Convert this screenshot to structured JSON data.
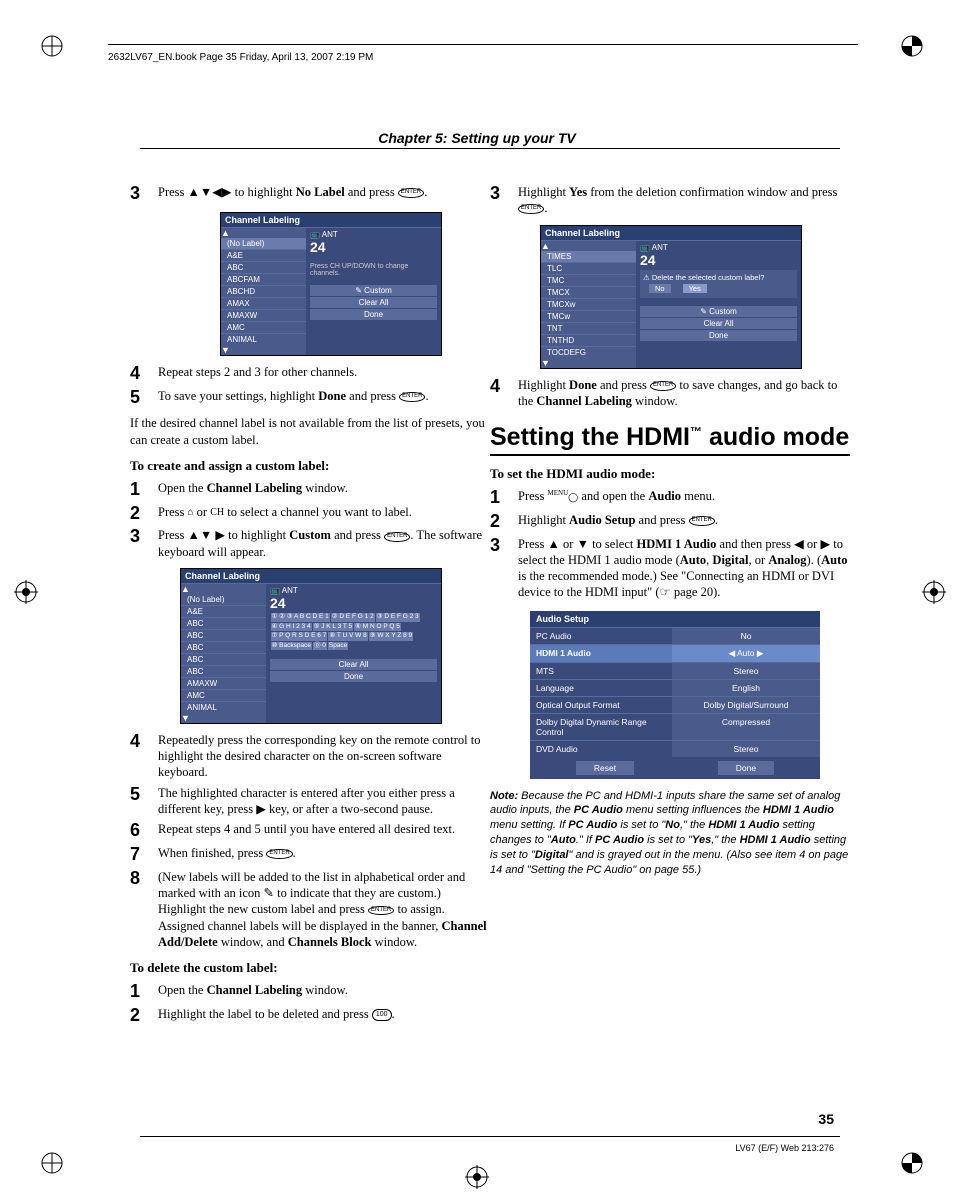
{
  "header": "2632LV67_EN.book  Page 35  Friday, April 13, 2007  2:19 PM",
  "chapter": "Chapter 5: Setting up your TV",
  "left": {
    "s3": {
      "pre": "Press ",
      "arrows": "▲▼◀▶",
      "mid": " to highlight ",
      "bold": "No Label",
      "post": " and press ",
      "enter": "ENTER",
      "end": "."
    },
    "menu1": {
      "title": "Channel Labeling",
      "items": [
        "(No Label)",
        "A&E",
        "ABC",
        "ABCFAM",
        "ABCHD",
        "AMAX",
        "AMAXW",
        "AMC",
        "ANIMAL"
      ],
      "ant": "ANT",
      "ch": "24",
      "hint": "Press CH UP/DOWN to change channels.",
      "btns": [
        "Custom",
        "Clear All",
        "Done"
      ]
    },
    "s4": "Repeat steps 2 and 3 for other channels.",
    "s5": {
      "pre": "To save your settings, highlight ",
      "bold": "Done",
      "post": " and press ",
      "enter": "ENTER",
      "end": "."
    },
    "para1": "If the desired channel label is not available from the list of presets, you can create a custom label.",
    "sub1": "To create and assign a custom label:",
    "c1": {
      "pre": "Open the ",
      "bold": "Channel Labeling",
      "post": " window."
    },
    "c2": {
      "pre": "Press ",
      "i1": "⌂",
      "mid": " or ",
      "i2": "CH",
      "post": " to select a channel you want to label."
    },
    "c3": {
      "pre": "Press ",
      "arrows": "▲▼ ▶",
      "mid": " to highlight ",
      "bold": "Custom",
      "post": " and press ",
      "enter": "ENTER",
      "end": ". The software keyboard will appear."
    },
    "menu2": {
      "title": "Channel Labeling",
      "items": [
        "(No Label)",
        "A&E",
        "ABC",
        "ABC",
        "ABC",
        "ABC",
        "ABC",
        "AMAXW",
        "AMC",
        "ANIMAL"
      ],
      "ant": "ANT",
      "ch": "24",
      "kbd": [
        "① ② ③ A B C D E 1",
        "④ G H I 2 3 4",
        "⑦ P Q R S D E 6 7",
        "⑩ Backspace",
        "② D E F G 1 2",
        "⑤ J K L 3 T 5",
        "⑧ T U V W 8",
        "⓪ 0",
        "③ D E F G 2 3",
        "⑥ M N O P Q 5",
        "⑨ W X Y Z 8 9",
        "Space"
      ],
      "btns": [
        "Clear All",
        "Done"
      ]
    },
    "c4": "Repeatedly press the corresponding key on the remote control to highlight the desired character on the on-screen software keyboard.",
    "c5": {
      "pre": "The highlighted character is entered after you either press a different key, press ",
      "arrow": "▶",
      "post": " key, or after a two-second pause."
    },
    "c6": "Repeat steps 4 and 5 until you have entered all desired text.",
    "c7": {
      "pre": "When finished, press ",
      "enter": "ENTER",
      "end": "."
    },
    "c8": {
      "a": "(New labels will be added to the list in alphabetical order and marked with an icon ",
      "b": " to indicate that they are custom.) Highlight the new custom label and press ",
      "enter": "ENTER",
      "c": " to assign. Assigned channel labels will be displayed in the banner, ",
      "bold1": "Channel Add/Delete",
      "d": " window, and ",
      "bold2": "Channels Block",
      "e": " window."
    },
    "sub2": "To delete the custom label:",
    "d1": {
      "pre": "Open the ",
      "bold": "Channel Labeling",
      "post": " window."
    },
    "d2": {
      "pre": "Highlight the label to be deleted and press ",
      "btn": "100",
      "end": "."
    }
  },
  "right": {
    "r3": {
      "pre": "Highlight ",
      "bold": "Yes",
      "post": " from the deletion confirmation window and press ",
      "enter": "ENTER",
      "end": "."
    },
    "menu3": {
      "title": "Channel Labeling",
      "items": [
        "TIMES",
        "TLC",
        "TMC",
        "TMCX",
        "TMCXw",
        "TMCw",
        "TNT",
        "TNTHD",
        "TOCDEFG"
      ],
      "ant": "ANT",
      "ch": "24",
      "dialog": "Delete the selected custom label?",
      "no": "No",
      "yes": "Yes",
      "btns": [
        "Custom",
        "Clear All",
        "Done"
      ]
    },
    "r4": {
      "pre": "Highlight ",
      "bold1": "Done",
      "mid": " and press ",
      "enter": "ENTER",
      "post": " to save changes, and go back to the ",
      "bold2": "Channel Labeling",
      "end": " window."
    },
    "section": {
      "a": "Setting the HDMI",
      "tm": "™",
      "b": " audio mode"
    },
    "sub": "To set the HDMI audio mode:",
    "h1": {
      "pre": "Press ",
      "btn": "MENU",
      "post": " and open the ",
      "bold": "Audio",
      "end": " menu."
    },
    "h2": {
      "pre": "Highlight ",
      "bold": "Audio Setup",
      "post": " and press ",
      "enter": "ENTER",
      "end": "."
    },
    "h3": {
      "a": "Press ",
      "up": "▲",
      "b": " or ",
      "dn": "▼",
      "c": " to select ",
      "bold1": "HDMI 1 Audio",
      "d": " and then press ",
      "lt": "◀",
      "e": " or ",
      "rt": "▶",
      "f": " to select the HDMI 1 audio mode (",
      "bold2": "Auto",
      "g": ", ",
      "bold3": "Digital",
      "h": ", or ",
      "bold4": "Analog",
      "i": "). (",
      "bold5": "Auto",
      "j": " is the recommended mode.) See \"Connecting an HDMI or DVI device to the HDMI input\" (",
      "pg": "☞ page 20",
      "k": ")."
    },
    "audio": {
      "title": "Audio Setup",
      "rows": [
        {
          "l": "PC Audio",
          "v": "No"
        },
        {
          "l": "HDMI 1 Audio",
          "v": "Auto",
          "hl": true,
          "arrows": true
        },
        {
          "l": "MTS",
          "v": "Stereo"
        },
        {
          "l": "Language",
          "v": "English"
        },
        {
          "l": "Optical Output Format",
          "v": "Dolby Digital/Surround"
        },
        {
          "l": "Dolby Digital Dynamic Range Control",
          "v": "Compressed"
        },
        {
          "l": "DVD Audio",
          "v": "Stereo"
        }
      ],
      "btns": [
        "Reset",
        "Done"
      ]
    },
    "note": {
      "nb": "Note:",
      "t1": " Because the PC and HDMI-1 inputs share the same set of analog audio inputs, the ",
      "b1": "PC Audio",
      "t2": " menu setting influences the ",
      "b2": "HDMI 1 Audio",
      "t3": " menu setting. If ",
      "b3": "PC Audio",
      "t4": " is set to \"",
      "b4": "No",
      "t5": ",\" the ",
      "b5": "HDMI 1 Audio",
      "t6": " setting changes to \"",
      "b6": "Auto",
      "t7": ".\" If ",
      "b7": "PC Audio",
      "t8": " is set to \"",
      "b8": "Yes",
      "t9": ",\" the ",
      "b9": "HDMI 1 Audio",
      "t10": " setting is set to \"",
      "b10": "Digital",
      "t11": "\" and is grayed out in the menu. (Also see item 4 on page 14 and \"Setting the PC Audio\" on page 55.)"
    }
  },
  "pageNum": "35",
  "footer": "LV67 (E/F) Web 213:276"
}
